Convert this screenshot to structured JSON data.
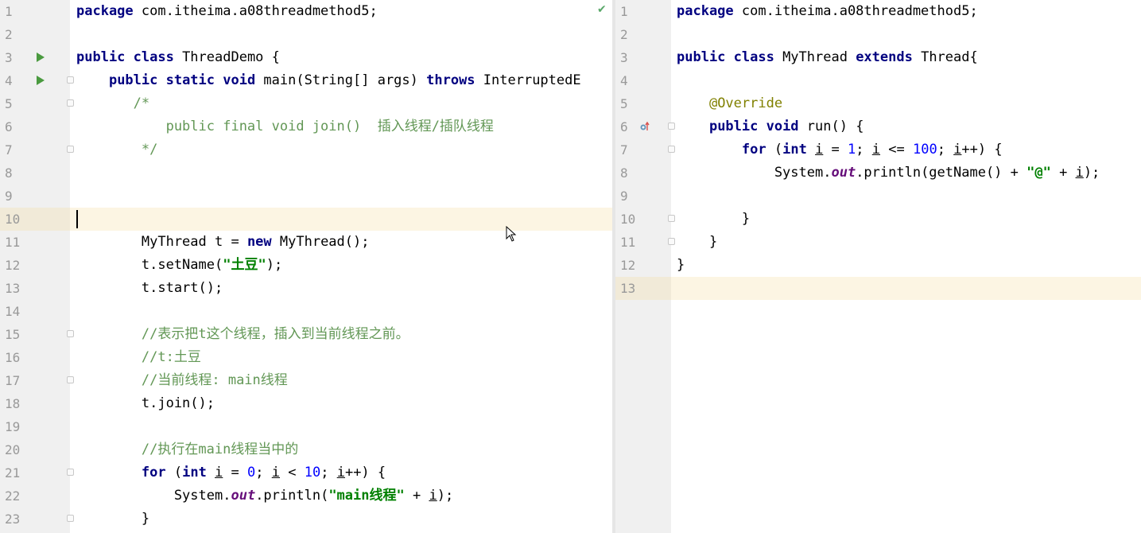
{
  "editor": {
    "left_file": {
      "lines": [
        {
          "n": "1",
          "code": "<span class=\"kw\">package</span> com.itheima.a08threadmethod5;"
        },
        {
          "n": "2",
          "code": ""
        },
        {
          "n": "3",
          "code": "<span class=\"kw\">public class</span> ThreadDemo {",
          "run": true
        },
        {
          "n": "4",
          "code": "    <span class=\"kw\">public static void</span> main(String[] args) <span class=\"kw\">throws</span> InterruptedE",
          "run": true,
          "fold": true
        },
        {
          "n": "5",
          "code": "       <span class=\"cm\">/*</span>",
          "fold": true
        },
        {
          "n": "6",
          "code": "<span class=\"cm\">           public final void join()  插入线程/插队线程</span>"
        },
        {
          "n": "7",
          "code": "<span class=\"cm\">        */</span>",
          "fold": true
        },
        {
          "n": "8",
          "code": ""
        },
        {
          "n": "9",
          "code": ""
        },
        {
          "n": "10",
          "code": "",
          "current": true
        },
        {
          "n": "11",
          "code": "        MyThread t = <span class=\"kw\">new</span> MyThread();"
        },
        {
          "n": "12",
          "code": "        t.setName(<span class=\"str\">\"土豆\"</span>);"
        },
        {
          "n": "13",
          "code": "        t.start();"
        },
        {
          "n": "14",
          "code": ""
        },
        {
          "n": "15",
          "code": "        <span class=\"cm\">//表示把t这个线程，插入到当前线程之前。</span>",
          "fold": true
        },
        {
          "n": "16",
          "code": "        <span class=\"cm\">//t:土豆</span>"
        },
        {
          "n": "17",
          "code": "        <span class=\"cm\">//当前线程: main线程</span>",
          "fold": true
        },
        {
          "n": "18",
          "code": "        t.join();"
        },
        {
          "n": "19",
          "code": ""
        },
        {
          "n": "20",
          "code": "        <span class=\"cm\">//执行在main线程当中的</span>"
        },
        {
          "n": "21",
          "code": "        <span class=\"kw\">for</span> (<span class=\"kw\">int</span> <span class=\"var\">i</span> = <span class=\"num\">0</span>; <span class=\"var\">i</span> &lt; <span class=\"num\">10</span>; <span class=\"var\">i</span>++) {",
          "fold": true
        },
        {
          "n": "22",
          "code": "            System.<span class=\"st\">out</span>.println(<span class=\"str\">\"main线程\"</span> + <span class=\"var\">i</span>);"
        },
        {
          "n": "23",
          "code": "        }",
          "fold": true
        }
      ]
    },
    "right_file": {
      "lines": [
        {
          "n": "1",
          "code": "<span class=\"kw\">package</span> com.itheima.a08threadmethod5;"
        },
        {
          "n": "2",
          "code": ""
        },
        {
          "n": "3",
          "code": "<span class=\"kw\">public class</span> MyThread <span class=\"kw\">extends</span> Thread{"
        },
        {
          "n": "4",
          "code": ""
        },
        {
          "n": "5",
          "code": "    <span class=\"ann\">@Override</span>"
        },
        {
          "n": "6",
          "code": "    <span class=\"kw\">public void</span> run() {",
          "override": true,
          "fold": true
        },
        {
          "n": "7",
          "code": "        <span class=\"kw\">for</span> (<span class=\"kw\">int</span> <span class=\"var\">i</span> = <span class=\"num\">1</span>; <span class=\"var\">i</span> &lt;= <span class=\"num\">100</span>; <span class=\"var\">i</span>++) {",
          "fold": true
        },
        {
          "n": "8",
          "code": "            System.<span class=\"st\">out</span>.println(getName() + <span class=\"str\">\"@\"</span> + <span class=\"var\">i</span>);"
        },
        {
          "n": "9",
          "code": ""
        },
        {
          "n": "10",
          "code": "        }",
          "fold": true
        },
        {
          "n": "11",
          "code": "    }",
          "fold": true
        },
        {
          "n": "12",
          "code": "}"
        },
        {
          "n": "13",
          "code": "",
          "current": true
        }
      ]
    },
    "status_icon": "check-icon",
    "status_glyph": "✔",
    "colors": {
      "keyword": "#000080",
      "string": "#008000",
      "comment": "#629755",
      "annotation": "#808000",
      "number": "#0000ff",
      "current_line": "#fcf5e3"
    }
  }
}
